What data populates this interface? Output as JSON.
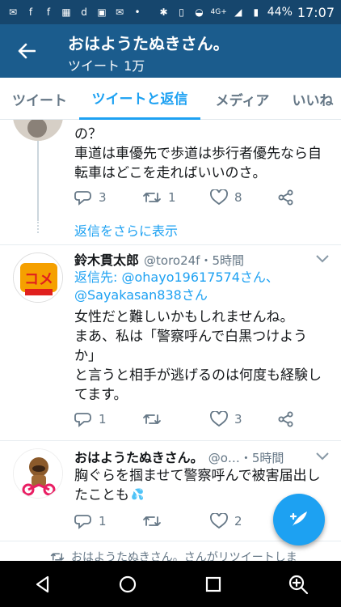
{
  "status_bar": {
    "battery": "44%",
    "time": "17:07",
    "network": "4G+"
  },
  "header": {
    "title": "おはようたぬきさん。",
    "subtitle": "ツイート 1万"
  },
  "tabs": [
    {
      "label": "ツイート",
      "active": false
    },
    {
      "label": "ツイートと返信",
      "active": true
    },
    {
      "label": "メディア",
      "active": false
    },
    {
      "label": "いいね",
      "active": false
    }
  ],
  "tweet1": {
    "text_line1": "の？",
    "text_line2": "車道は車優先で歩道は歩行者優先なら自",
    "text_line3": "転車はどこを走ればいいのさ。",
    "reply_count": "3",
    "retweet_count": "1",
    "like_count": "8"
  },
  "more_replies": "返信をさらに表示",
  "tweet2": {
    "name": "鈴木貫太郎",
    "meta": "@toro24f・5時間",
    "reply_prefix": "返信先: ",
    "reply_user1": "@ohayo19617574さん、",
    "reply_user2": "@Sayakasan838さん",
    "text_line1": "女性だと難しいかもしれませんね。",
    "text_line2": "まあ、私は「警察呼んで白黒つけよう",
    "text_line3": "か」",
    "text_line4": "と言うと相手が逃げるのは何度も経験し",
    "text_line5": "てます。",
    "reply_count": "1",
    "retweet_count": "",
    "like_count": "3"
  },
  "tweet3": {
    "name": "おはようたぬきさん。",
    "meta": "@o…・5時間",
    "text_line1": "胸ぐらを掴ませて警察呼んで被害届出し",
    "text_line2": "たことも",
    "reply_count": "1",
    "retweet_count": "",
    "like_count": "2"
  },
  "retweet_notice": "おはようたぬきさん。さんがリツイートしま",
  "colors": {
    "accent": "#1da1f2",
    "header_bg": "#1b5c8d",
    "status_bg": "#16466d"
  }
}
